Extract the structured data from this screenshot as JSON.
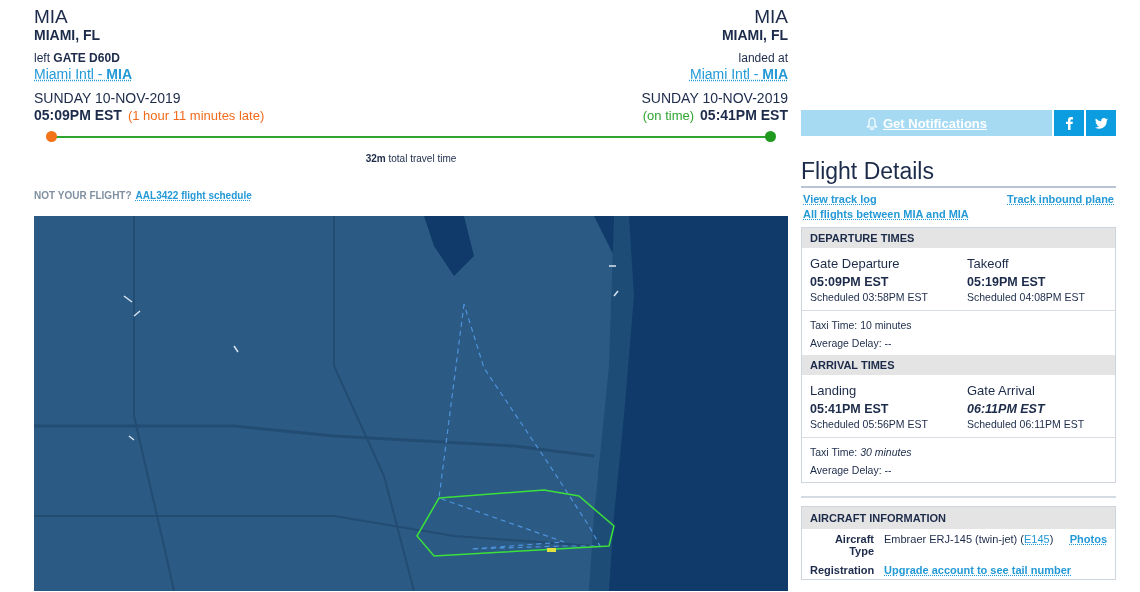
{
  "origin": {
    "code": "MIA",
    "city": "MIAMI, FL",
    "gate": "left **GATE D60D**",
    "airport": "Miami Intl - **MIA**",
    "date": "SUNDAY 10-NOV-2019",
    "time": "05:09PM EST",
    "status": "(1 hour 11 minutes late)",
    "kind": "late"
  },
  "destination": {
    "code": "MIA",
    "city": "MIAMI, FL",
    "gate": "landed at",
    "airport": "Miami Intl - **MIA**",
    "date": "SUNDAY 10-NOV-2019",
    "time": "05:41PM EST",
    "status": "(on time)",
    "kind": "on_time"
  },
  "progress": {
    "level": 1
  },
  "travel_time": "**32m** total travel time",
  "not_your_flight": {
    "label": "NOT YOUR FLIGHT?",
    "link": "AAL3422 flight schedule"
  },
  "notifications": {
    "label": "Get Notifications"
  },
  "flight_details": {
    "title": "Flight Details",
    "links": [
      "View track log",
      "Track inbound plane",
      "All flights between MIA and MIA"
    ]
  },
  "sections": [
    {
      "title": "DEPARTURE TIMES",
      "cells": [
        {
          "label": "Gate Departure",
          "time": "05:09PM EST",
          "estimated": false,
          "scheduled": "Scheduled 03:58PM EST"
        },
        {
          "label": "Takeoff",
          "time": "05:19PM EST",
          "estimated": false,
          "scheduled": "Scheduled 04:08PM EST"
        }
      ],
      "facts": [
        {
          "label": "Taxi Time:",
          "value": "10 minutes",
          "estimated": false
        },
        {
          "label": "Average Delay:",
          "value": "--",
          "estimated": false
        }
      ]
    },
    {
      "title": "ARRIVAL TIMES",
      "cells": [
        {
          "label": "Landing",
          "time": "05:41PM EST",
          "estimated": false,
          "scheduled": "Scheduled 05:56PM EST"
        },
        {
          "label": "Gate Arrival",
          "time": "06:11PM EST",
          "estimated": true,
          "scheduled": "Scheduled 06:11PM EST"
        }
      ],
      "facts": [
        {
          "label": "Taxi Time:",
          "value": "30 minutes",
          "estimated": true
        },
        {
          "label": "Average Delay:",
          "value": "--",
          "estimated": false
        }
      ]
    }
  ],
  "aircraft": {
    "title": "AIRCRAFT INFORMATION",
    "rows": [
      {
        "label": "Aircraft Type",
        "value": "Embraer ERJ-145 (twin-jet) (",
        "link": "E145",
        "after": ")",
        "side_link": "Photos"
      },
      {
        "label": "Registration",
        "link": "Upgrade account to see tail number"
      }
    ]
  }
}
